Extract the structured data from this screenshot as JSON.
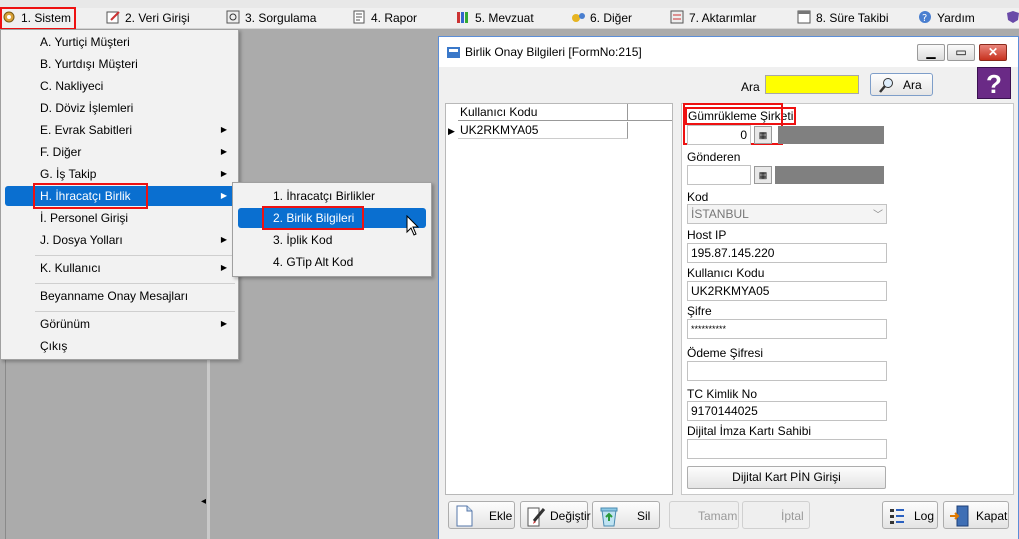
{
  "menubar": {
    "items": [
      {
        "label": "1. Sistem"
      },
      {
        "label": "2. Veri Girişi"
      },
      {
        "label": "3. Sorgulama"
      },
      {
        "label": "4. Rapor"
      },
      {
        "label": "5. Mevzuat"
      },
      {
        "label": "6. Diğer"
      },
      {
        "label": "7. Aktarımlar"
      },
      {
        "label": "8. Süre Takibi"
      },
      {
        "label": "Yardım"
      }
    ]
  },
  "sistem_menu": {
    "items": [
      {
        "label": "A. Yurtiçi Müşteri"
      },
      {
        "label": "B. Yurtdışı Müşteri"
      },
      {
        "label": "C. Nakliyeci"
      },
      {
        "label": "D. Döviz İşlemleri"
      },
      {
        "label": "E. Evrak Sabitleri"
      },
      {
        "label": "F. Diğer"
      },
      {
        "label": "G. İş Takip"
      },
      {
        "label": "H. İhracatçı Birlik"
      },
      {
        "label": "İ. Personel Girişi"
      },
      {
        "label": "J. Dosya Yolları"
      },
      {
        "label": "K. Kullanıcı"
      },
      {
        "label": "Beyanname Onay Mesajları"
      },
      {
        "label": "Görünüm"
      },
      {
        "label": "Çıkış"
      }
    ]
  },
  "submenu": {
    "items": [
      {
        "label": "1. İhracatçı Birlikler"
      },
      {
        "label": "2. Birlik Bilgileri"
      },
      {
        "label": "3. İplik Kod"
      },
      {
        "label": "4. GTip Alt Kod"
      }
    ]
  },
  "window": {
    "title": "Birlik Onay Bilgileri [FormNo:215]",
    "search_label": "Ara",
    "search_button": "Ara",
    "help": "?"
  },
  "grid": {
    "column": "Kullanıcı Kodu",
    "rows": [
      "UK2RKMYA05"
    ]
  },
  "form": {
    "gumrukleme_label": "Gümrükleme Şirketi",
    "gumrukleme_value": "0",
    "gonderen_label": "Gönderen",
    "kod_label": "Kod",
    "kod_value": "İSTANBUL",
    "host_label": "Host IP",
    "host_value": "195.87.145.220",
    "kullanici_label": "Kullanıcı Kodu",
    "kullanici_value": "UK2RKMYA05",
    "sifre_label": "Şifre",
    "sifre_value": "**********",
    "odeme_label": "Ödeme Şifresi",
    "tc_label": "TC Kimlik No",
    "tc_value": "9170144025",
    "dijital_label": "Dijital İmza Kartı Sahibi",
    "dijital_button": "Dijital Kart PİN Girişi"
  },
  "toolbar": {
    "ekle": "Ekle",
    "degistir": "Değiştir",
    "sil": "Sil",
    "tamam": "Tamam",
    "iptal": "İptal",
    "log": "Log",
    "kapat": "Kapat"
  }
}
